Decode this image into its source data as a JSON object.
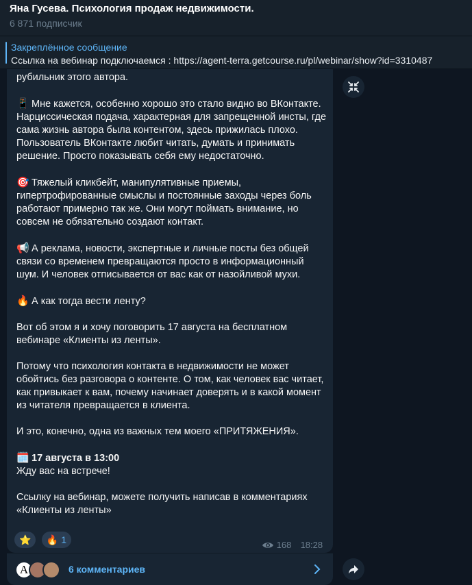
{
  "channel": {
    "title": "Яна Гусева. Психология продаж недвижимости.",
    "subscribers": "6 871 подписчик"
  },
  "pinned": {
    "title": "Закреплённое сообщение",
    "text": "Ссылка на вебинар подключаемся : https://agent-terra.getcourse.ru/pl/webinar/show?id=3310487"
  },
  "message": {
    "p0": "рубильник этого автора.",
    "p1_emoji": "📱",
    "p1": "Мне кажется, особенно хорошо это стало видно во ВКонтакте. Нарциссическая подача, характерная для запрещенной инсты, где сама жизнь автора была контентом, здесь прижилась плохо. Пользователь ВКонтакте любит читать, думать и принимать решение. Просто показывать себя ему недостаточно.",
    "p2_emoji": "🎯",
    "p2": "Тяжелый кликбейт, манипулятивные приемы, гипертрофированные смыслы и постоянные заходы через боль работают примерно так же. Они могут поймать внимание, но совсем не обязательно создают контакт.",
    "p3_emoji": "📢",
    "p3": "А реклама, новости, экспертные и личные посты без общей связи со временем превращаются просто в информационный шум. И человек отписывается от вас как от назойливой мухи.",
    "p4_emoji": "🔥",
    "p4": "А как тогда вести ленту?",
    "p5": "Вот об этом я и хочу поговорить 17 августа на бесплатном вебинаре «Клиенты из ленты».",
    "p6": "Потому что психология контакта в недвижимости не может обойтись без разговора о контенте. О том, как человек вас читает, как привыкает к вам, почему начинает доверять и в какой момент из читателя превращается в клиента.",
    "p7": "И это, конечно, одна из важных тем моего «ПРИТЯЖЕНИЯ».",
    "p8_emoji": "🗓️",
    "p8_bold": "17 августа в 13:00",
    "p8b": "Жду вас на встрече!",
    "p9": "Ссылку на вебинар, можете получить написав в комментариях «Клиенты из ленты»"
  },
  "reactions": [
    {
      "emoji": "⭐",
      "count": ""
    },
    {
      "emoji": "🔥",
      "count": "1"
    }
  ],
  "meta": {
    "views": "168",
    "time": "18:28"
  },
  "comments": {
    "avatar_letter": "A",
    "label": "6 комментариев"
  },
  "icons": {
    "expand": "collapse-arrows-icon",
    "share": "share-arrow-icon",
    "views": "eye-icon",
    "chevron": "chevron-right-icon"
  },
  "colors": {
    "accent": "#5eb5f7",
    "bubble": "#182533",
    "background": "#0e1621"
  }
}
